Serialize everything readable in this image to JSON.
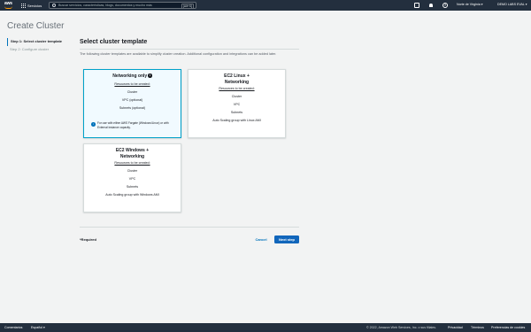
{
  "topnav": {
    "logo_text": "aws",
    "services_label": "Servicios",
    "search_placeholder": "Buscar servicios, características, blogs, documentos y mucho más",
    "search_shortcut": "[Alt+S]",
    "help_glyph": "?",
    "region": "Norte de Virginia ▾",
    "account": "DEMO LABS EVAL ▾"
  },
  "page": {
    "title": "Create Cluster"
  },
  "steps": [
    {
      "label": "Step 1: Select cluster template",
      "active": true
    },
    {
      "label": "Step 2: Configure cluster",
      "active": false
    }
  ],
  "main": {
    "section_title": "Select cluster template",
    "description": "The following cluster templates are available to simplify cluster creation. Additional configuration and integrations can be added later."
  },
  "cards": [
    {
      "title": "Networking only",
      "resources_label": "Resources to be created:",
      "items": [
        "Cluster",
        "VPC (optional)",
        "Subnets (optional)"
      ],
      "note": "For use with either AWS Fargate (Windows/Linux) or with External instance capacity.",
      "selected": true
    },
    {
      "title_line1": "EC2 Linux +",
      "title_line2": "Networking",
      "resources_label": "Resources to be created:",
      "items": [
        "Cluster",
        "VPC",
        "Subnets",
        "Auto Scaling group with Linux AMI"
      ]
    },
    {
      "title_line1": "EC2 Windows +",
      "title_line2": "Networking",
      "resources_label": "Resources to be created:",
      "items": [
        "Cluster",
        "VPC",
        "Subnets",
        "Auto Scaling group with Windows AMI"
      ]
    }
  ],
  "footer": {
    "required_label": "*Required",
    "cancel_label": "Cancel",
    "next_label": "Next step"
  },
  "bottombar": {
    "feedback": "Comentarios",
    "language": "Español ▾",
    "copyright": "© 2022, Amazon Web Services, Inc. o sus filiales.",
    "privacy": "Privacidad",
    "terms": "Términos",
    "cookies": "Preferencias de cookies"
  },
  "colors": {
    "nav_bg": "#232f3e",
    "accent": "#0073bb",
    "selected_border": "#00a1c9",
    "primary_button": "#1166bb"
  }
}
